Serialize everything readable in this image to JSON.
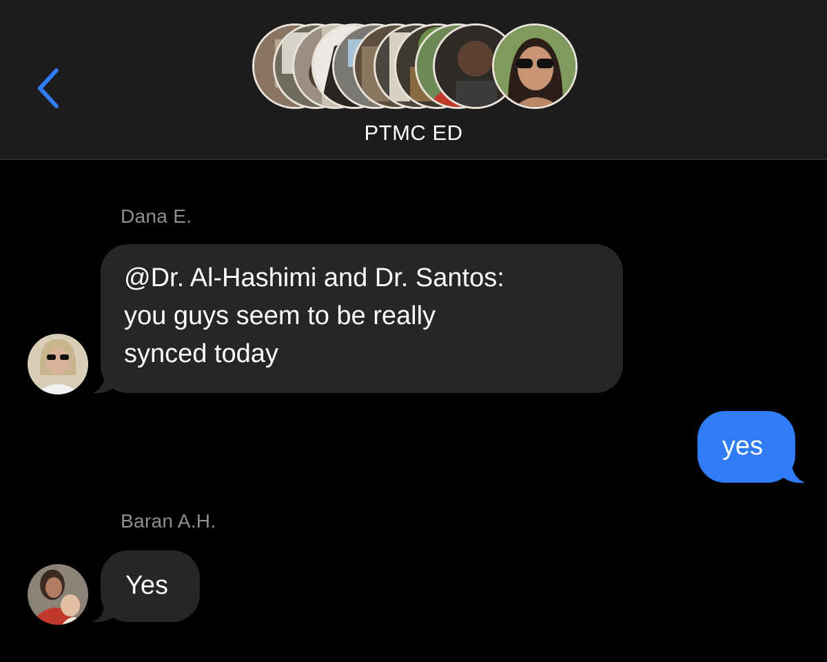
{
  "header": {
    "group_name": "PTMC ED",
    "back_icon": "chevron-left-icon",
    "accent_color": "#2f7cf6",
    "participant_count": 9
  },
  "messages": [
    {
      "sender": "Dana E.",
      "direction": "incoming",
      "text": "@Dr. Al-Hashimi and Dr. Santos:\nyou guys seem to be really\nsynced today"
    },
    {
      "sender": "",
      "direction": "outgoing",
      "text": "yes"
    },
    {
      "sender": "Baran A.H.",
      "direction": "incoming",
      "text": "Yes"
    }
  ],
  "colors": {
    "background": "#000000",
    "header_background": "#1c1c1e",
    "incoming_bubble": "#262629",
    "outgoing_bubble": "#2f7cf6",
    "sender_name": "#8e8e93"
  }
}
